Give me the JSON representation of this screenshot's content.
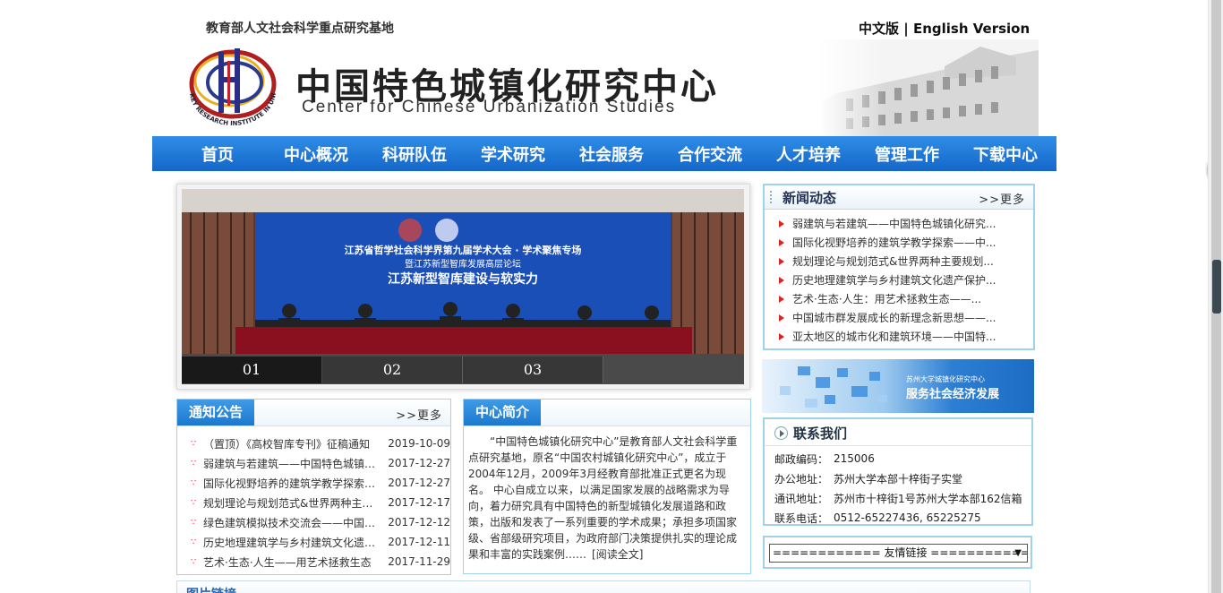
{
  "header": {
    "top_left": "教育部人文社会科学重点研究基地",
    "lang_cn": "中文版",
    "lang_sep": "|",
    "lang_en": "English Version",
    "title": "中国特色城镇化研究中心",
    "subtitle": "Center for Chinese Urbanization Studies",
    "logo_ring_text": "KEY RESEARCH INSTITUTE IN UNIVERSITY"
  },
  "nav": [
    "首页",
    "中心概况",
    "科研队伍",
    "学术研究",
    "社会服务",
    "合作交流",
    "人才培养",
    "管理工作",
    "下载中心"
  ],
  "slideshow": {
    "banner_line1": "江苏省哲学社会科学界第九届学术大会 · 学术聚焦专场",
    "banner_line2": "暨江苏新型智库发展高层论坛",
    "banner_line3": "江苏新型智库建设与软实力",
    "tabs": [
      "01",
      "02",
      "03"
    ],
    "active_tab": 0
  },
  "news": {
    "title": "新闻动态",
    "more": ">>更多",
    "items": [
      "弱建筑与若建筑——中国特色城镇化研究...",
      "国际化视野培养的建筑学教学探索——中...",
      "规划理论与规划范式&世界两种主要规划...",
      "历史地理建筑学与乡村建筑文化遗产保护...",
      "艺术·生态·人生：用艺术拯救生态——...",
      "中国城市群发展成长的新理念新思想——...",
      "亚太地区的城市化和建筑环境——中国特..."
    ]
  },
  "banner": {
    "small": "苏州大学城镇化研究中心",
    "big": "服务社会经济发展"
  },
  "contact": {
    "title": "联系我们",
    "rows": [
      {
        "k": "邮政编码：",
        "v": "215006"
      },
      {
        "k": "办公地址：",
        "v": "苏州大学本部十梓街子实堂"
      },
      {
        "k": "通讯地址：",
        "v": "苏州市十梓街1号苏州大学本部162信箱"
      },
      {
        "k": "联系电话：",
        "v": "0512-65227436, 65225275"
      }
    ]
  },
  "links": {
    "selected": "============ 友情链接 ============"
  },
  "notices": {
    "title": "通知公告",
    "more": ">>更多",
    "items": [
      {
        "t": "（置顶）《高校智库专刊》征稿通知",
        "d": "2019-10-09"
      },
      {
        "t": "弱建筑与若建筑——中国特色城镇化研究中心",
        "d": "2017-12-27"
      },
      {
        "t": "国际化视野培养的建筑学教学探索——中国",
        "d": "2017-12-27"
      },
      {
        "t": "规划理论与规划范式&世界两种主要规划",
        "d": "2017-12-17"
      },
      {
        "t": "绿色建筑模拟技术交流会——中国特色城镇化",
        "d": "2017-12-12"
      },
      {
        "t": "历史地理建筑学与乡村建筑文化遗产保护",
        "d": "2017-12-11"
      },
      {
        "t": "艺术·生态·人生——用艺术拯救生态",
        "d": "2017-11-29"
      }
    ]
  },
  "intro": {
    "title": "中心简介",
    "text": "“中国特色城镇化研究中心”是教育部人文社会科学重点研究基地，原名“中国农村城镇化研究中心”，成立于2004年12月，2009年3月经教育部批准正式更名为现名。 中心自成立以来，以满足国家发展的战略需求为导向，着力研究具有中国特色的新型城镇化发展道路和政策，出版和发表了一系列重要的学术成果；承担多项国家级、省部级研究项目，为政府部门决策提供扎实的理论成果和丰富的实践案例……",
    "readmore": "[阅读全文]"
  },
  "pictures": {
    "title": "图片链接"
  },
  "widget": {
    "value": "62"
  },
  "colors": {
    "nav_blue": "#1f7ad9",
    "panel_border": "#9fd3e8",
    "accent_red": "#d22222"
  }
}
